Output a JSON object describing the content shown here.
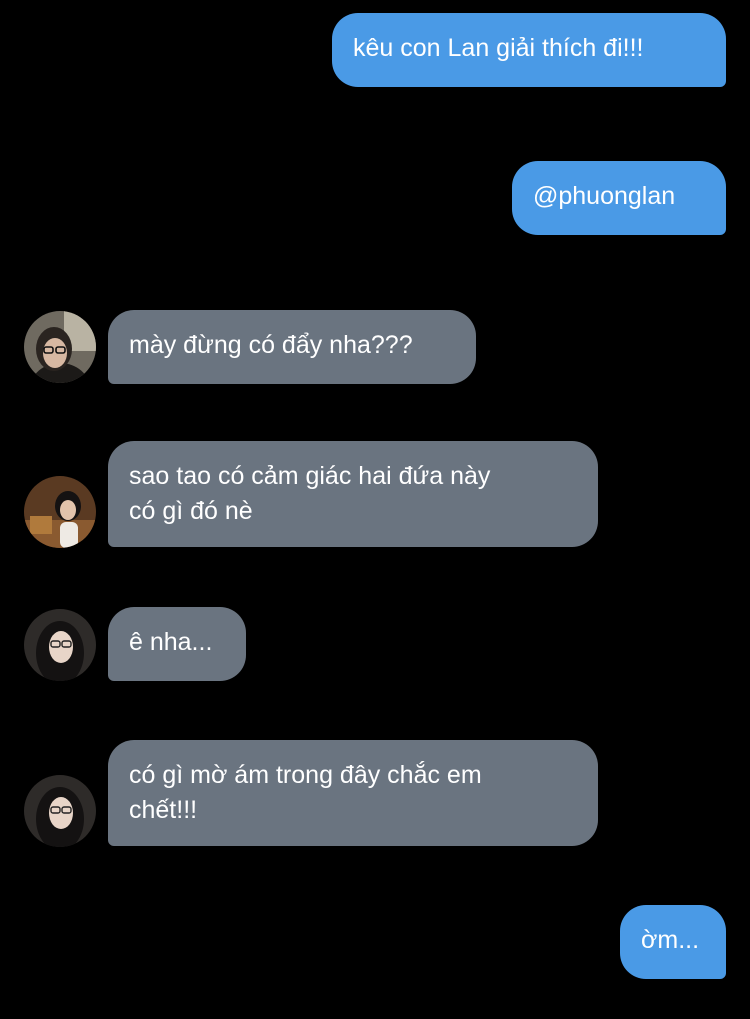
{
  "chat": {
    "messages": [
      {
        "id": "m1",
        "direction": "outgoing",
        "text": "kêu con Lan giải thích đi!!!"
      },
      {
        "id": "m2",
        "direction": "outgoing",
        "text": "@phuonglan"
      },
      {
        "id": "m3",
        "direction": "incoming",
        "text": "mày đừng có đẩy nha???",
        "avatar_icon": "avatar-glasses-icon"
      },
      {
        "id": "m4",
        "direction": "incoming",
        "text": "sao tao có cảm giác hai đứa này\ncó gì đó nè",
        "avatar_icon": "avatar-bob-hair-icon"
      },
      {
        "id": "m5",
        "direction": "incoming",
        "text": "ê nha...",
        "avatar_icon": "avatar-long-hair-glasses-icon"
      },
      {
        "id": "m6",
        "direction": "incoming",
        "text": "có gì mờ ám trong đây chắc em\nchết!!!",
        "avatar_icon": "avatar-long-hair-glasses-icon"
      },
      {
        "id": "m7",
        "direction": "outgoing",
        "text": "ờm..."
      }
    ]
  },
  "colors": {
    "background": "#000000",
    "outgoing_bubble": "#4a9ae6",
    "incoming_bubble": "#6a7480",
    "text": "#ffffff"
  }
}
